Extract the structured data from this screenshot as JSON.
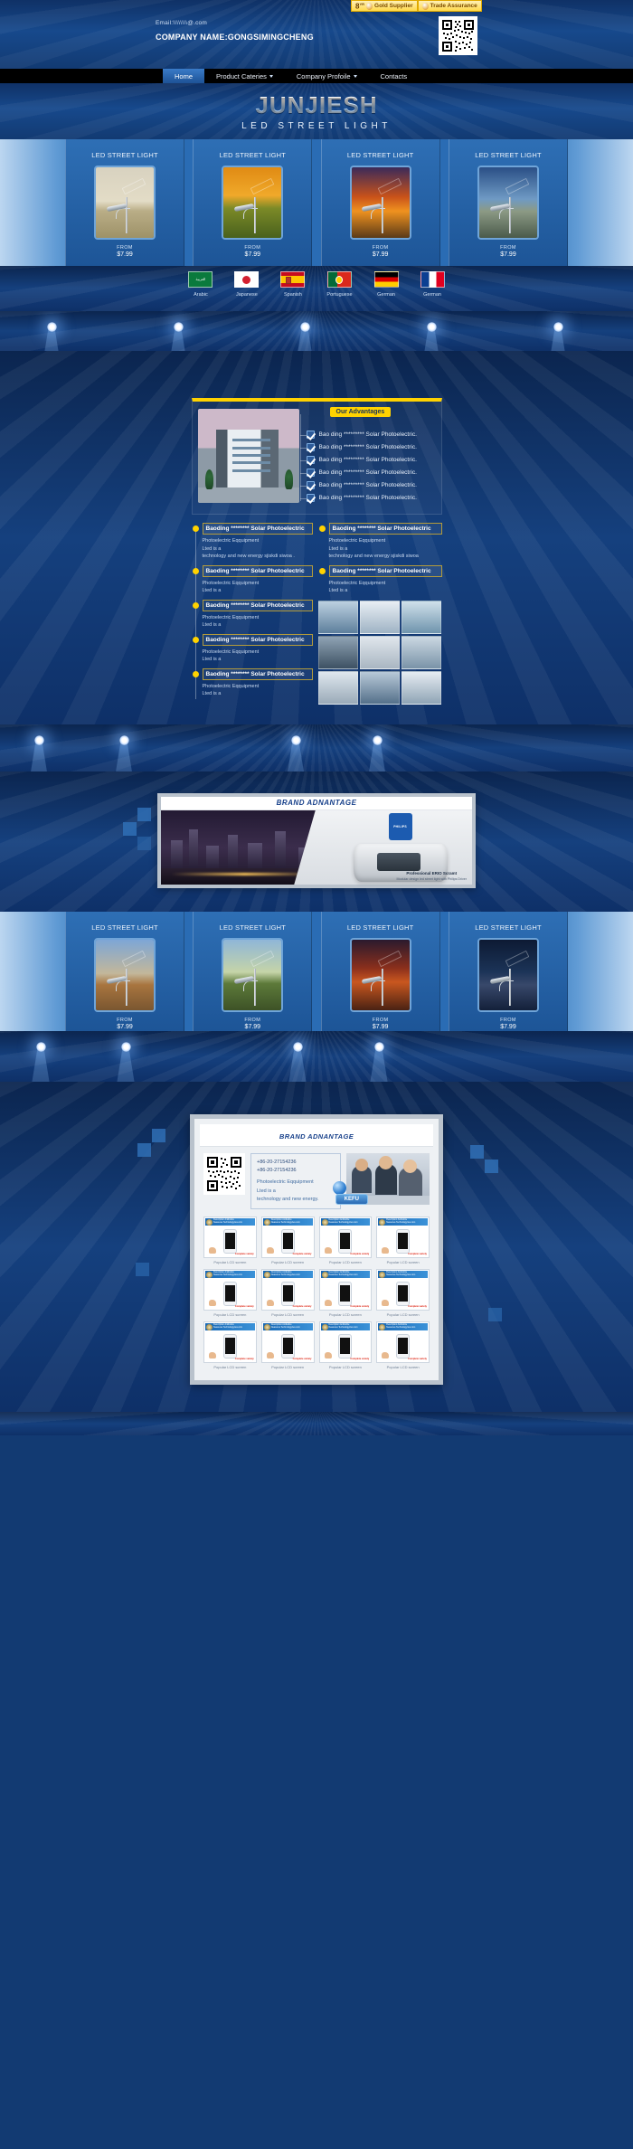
{
  "header": {
    "email": "Email:\\\\\\\\\\\\\\\\@.com",
    "company": "COMPANY NAME:GONGSIMINGCHENG",
    "qr_icon": "qr-code-icon",
    "badges": [
      {
        "years": "8",
        "years_sup": "YR",
        "label": "Gold Supplier",
        "icon": "gold-medal-icon"
      },
      {
        "label": "Trade Assurance",
        "icon": "shield-icon"
      }
    ]
  },
  "nav": {
    "items": [
      {
        "label": "Home",
        "active": true,
        "caret": false
      },
      {
        "label": "Product Cateries",
        "active": false,
        "caret": true
      },
      {
        "label": "Company Profoile",
        "active": false,
        "caret": true
      },
      {
        "label": "Contacts",
        "active": false,
        "caret": false
      }
    ]
  },
  "hero": {
    "title": "JUNJIESH",
    "subtitle": "LED STREET LIGHT"
  },
  "products_top": [
    {
      "title": "LED STREET LIGHT",
      "from_label": "FROM",
      "price": "$7.99",
      "scene": "dawn-field"
    },
    {
      "title": "LED STREET LIGHT",
      "from_label": "FROM",
      "price": "$7.99",
      "scene": "golden-forest"
    },
    {
      "title": "LED STREET LIGHT",
      "from_label": "FROM",
      "price": "$7.99",
      "scene": "orange-sunset"
    },
    {
      "title": "LED STREET LIGHT",
      "from_label": "FROM",
      "price": "$7.99",
      "scene": "blue-mountain"
    }
  ],
  "languages": [
    {
      "label": "Arabic",
      "flag": "flag-ar",
      "script": "العربية"
    },
    {
      "label": "Japanese",
      "flag": "flag-jp"
    },
    {
      "label": "Spanish",
      "flag": "flag-es"
    },
    {
      "label": "Portuguese",
      "flag": "flag-pt"
    },
    {
      "label": "German",
      "flag": "flag-de"
    },
    {
      "label": "German",
      "flag": "flag-fr"
    }
  ],
  "advantages": {
    "pill": "Our Advantages",
    "photo_alt": "office-building-photo",
    "items": [
      "Bao ding ********* Solar Photoelectric.",
      "Bao ding ********* Solar Photoelectric.",
      "Bao ding ********* Solar Photoelectric.",
      "Bao ding ********* Solar Photoelectric.",
      "Bao ding ********* Solar Photoelectric.",
      "Bao ding ********* Solar Photoelectric."
    ]
  },
  "timeline_left": [
    {
      "head": "Baoding ******** Solar Photoelectric",
      "body": "Photoelectric Eqquipment\nLted is a\ntechnology and new energy  sjiskdi siwoa ."
    },
    {
      "head": "Baoding ******** Solar Photoelectric",
      "body": "Photoelectric Eqquipment\nLted is a"
    },
    {
      "head": "Baoding ******** Solar Photoelectric",
      "body": "Photoelectric Eqquipment\nLted is a"
    },
    {
      "head": "Baoding ******** Solar Photoelectric",
      "body": "Photoelectric Eqquipment\nLted is a"
    },
    {
      "head": "Baoding ******** Solar Photoelectric",
      "body": "Photoelectric Eqquipment\nLted is a"
    }
  ],
  "timeline_right": [
    {
      "head": "Baoding ******** Solar Photoelectric",
      "body": "Photoelectric Eqquipment\nLted is a\ntechnology and new energy  sjiskdi siwoa"
    },
    {
      "head": "Baoding ******** Solar Photoelectric",
      "body": "Photoelectric Eqquipment\nLted is a"
    }
  ],
  "gallery": [
    "factory-photo-1",
    "factory-photo-2",
    "factory-photo-3",
    "factory-photo-4",
    "factory-photo-5",
    "factory-photo-6",
    "factory-photo-7",
    "factory-photo-8",
    "factory-photo-9"
  ],
  "brand_banner": {
    "title": "BRAND ADNANTAGE",
    "logo": "philips-logo",
    "logo_text": "PHILIPS",
    "caption_1": "Professional ERIO Scramt",
    "caption_2": "Modular design led street light with Philips Driver",
    "city_alt": "night-city-highway-photo",
    "lamp_alt": "led-street-lamp-product"
  },
  "products_bottom": [
    {
      "title": "LED STREET LIGHT",
      "from_label": "FROM",
      "price": "$7.99",
      "scene": "canyon-desert"
    },
    {
      "title": "LED STREET LIGHT",
      "from_label": "FROM",
      "price": "$7.99",
      "scene": "green-road"
    },
    {
      "title": "LED STREET LIGHT",
      "from_label": "FROM",
      "price": "$7.99",
      "scene": "autumn-red"
    },
    {
      "title": "LED STREET LIGHT",
      "from_label": "FROM",
      "price": "$7.99",
      "scene": "night-blue"
    }
  ],
  "kefu": {
    "title": "BRAND ADNANTAGE",
    "qr_icon": "qr-code-icon",
    "phone_1": "+86-20-27154236",
    "phone_2": "+86-20-27154236",
    "desc": "Photoelectric Eqquipment\nLted is a\ntechnology and new energy.",
    "button_label": "KEFU",
    "ball_icon": "chat-bubble-icon",
    "photo_alt": "customer-service-team-photo",
    "cards": [
      {
        "top_text": "Description Antibolize\nNeasures Technologyries.com",
        "badge": "Complete variety",
        "caption": "Popular LCD screen"
      },
      {
        "top_text": "Description Antibolize\nNeasures Technologyries.com",
        "badge": "Complete variety",
        "caption": "Popular LCD screen"
      },
      {
        "top_text": "Description Antibolize\nNeasures Technologyries.com",
        "badge": "Complete variety",
        "caption": "Popular LCD screen"
      },
      {
        "top_text": "Description Antibolize\nNeasures Technologyries.com",
        "badge": "Complete variety",
        "caption": "Popular LCD screen"
      },
      {
        "top_text": "Description Antibolize\nNeasures Technologyries.com",
        "badge": "Complete variety",
        "caption": "Popular LCD screen"
      },
      {
        "top_text": "Description Antibolize\nNeasures Technologyries.com",
        "badge": "Complete variety",
        "caption": "Popular LCD screen"
      },
      {
        "top_text": "Description Antibolize\nNeasures Technologyries.com",
        "badge": "Complete variety",
        "caption": "Popular LCD screen"
      },
      {
        "top_text": "Description Antibolize\nNeasures Technologyries.com",
        "badge": "Complete variety",
        "caption": "Popular LCD screen"
      },
      {
        "top_text": "Description Antibolize\nNeasures Technologyries.com",
        "badge": "Complete variety",
        "caption": "Popular LCD screen"
      },
      {
        "top_text": "Description Antibolize\nNeasures Technologyries.com",
        "badge": "Complete variety",
        "caption": "Popular LCD screen"
      },
      {
        "top_text": "Description Antibolize\nNeasures Technologyries.com",
        "badge": "Complete variety",
        "caption": "Popular LCD screen"
      },
      {
        "top_text": "Description Antibolize\nNeasures Technologyries.com",
        "badge": "Complete variety",
        "caption": "Popular LCD screen"
      }
    ]
  },
  "colors": {
    "brand_blue": "#17498c",
    "accent_yellow": "#ffd200",
    "nav_black": "#000000",
    "link_blue": "#3a7bc8"
  }
}
